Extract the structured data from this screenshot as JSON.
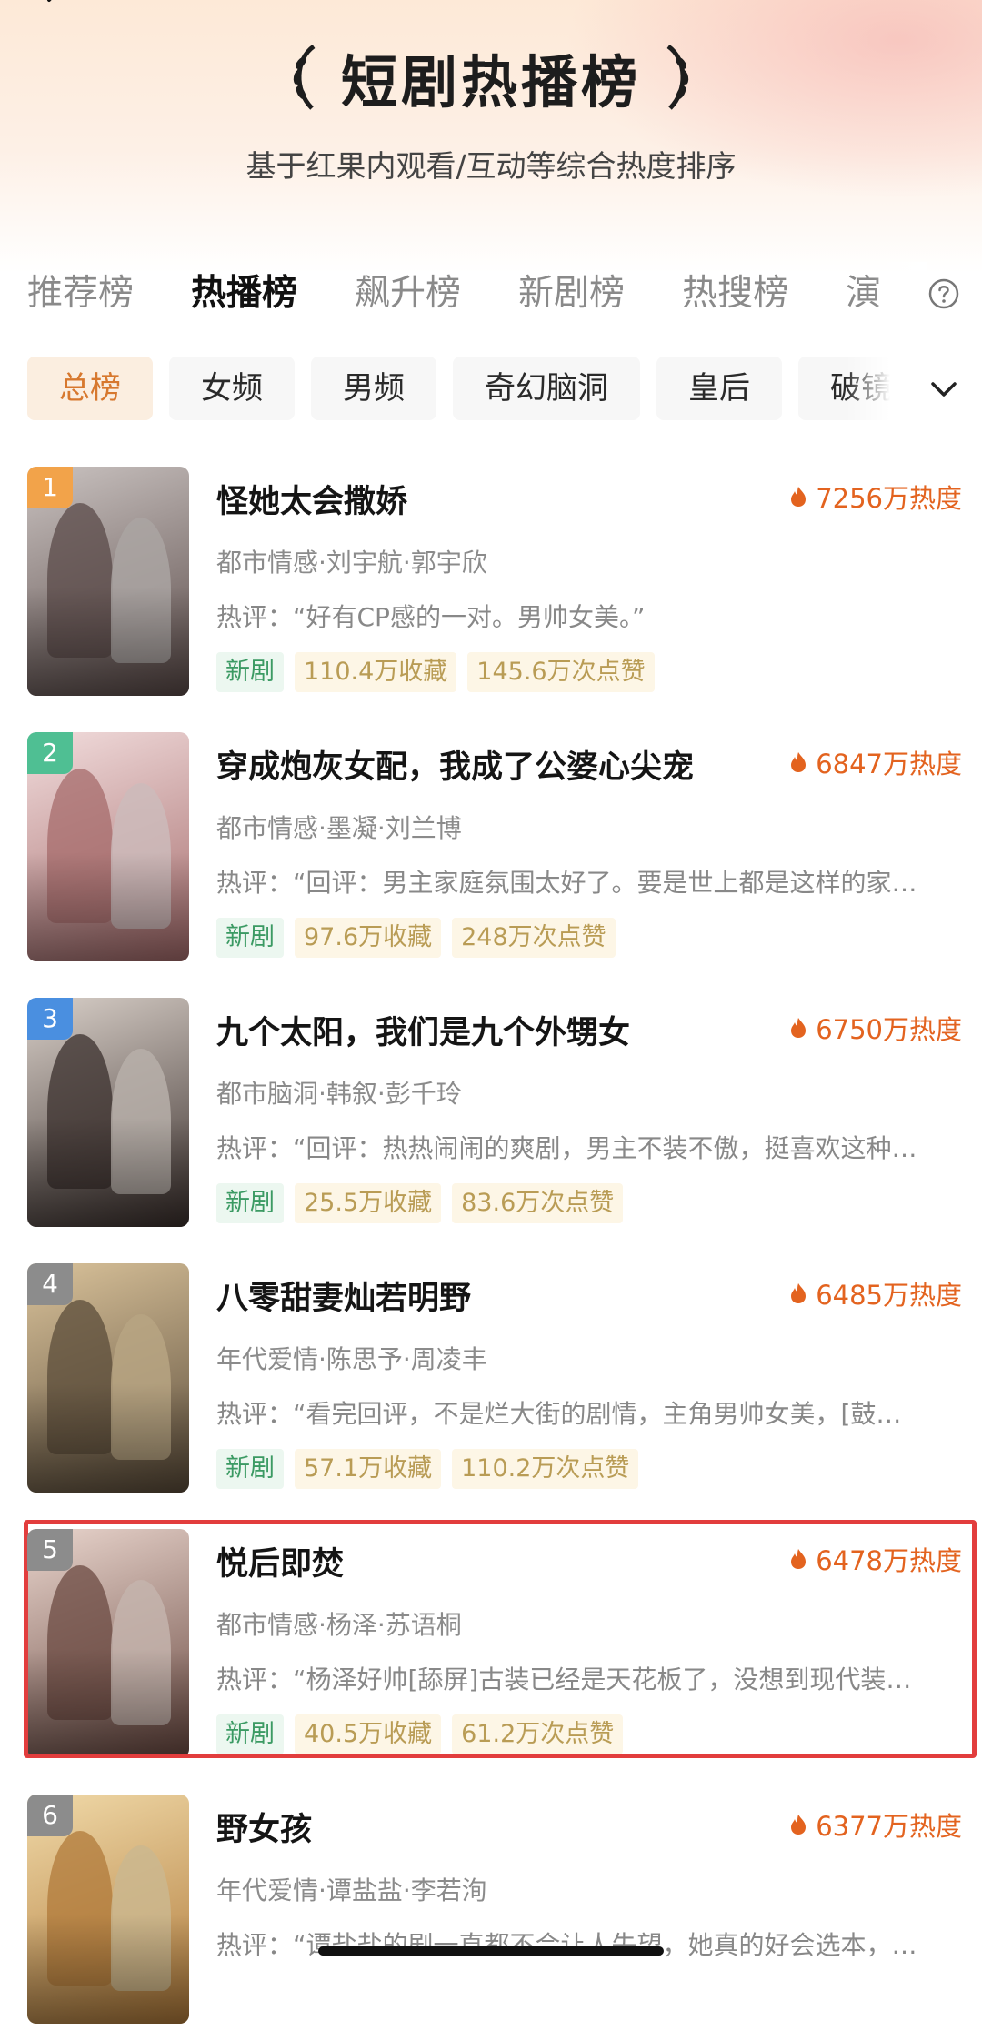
{
  "header": {
    "title": "短剧热播榜",
    "subtitle": "基于红果内观看/互动等综合热度排序"
  },
  "tabs": [
    {
      "label": "推荐榜",
      "active": false
    },
    {
      "label": "热播榜",
      "active": true
    },
    {
      "label": "飙升榜",
      "active": false
    },
    {
      "label": "新剧榜",
      "active": false
    },
    {
      "label": "热搜榜",
      "active": false
    },
    {
      "label": "演",
      "active": false
    }
  ],
  "chips": [
    {
      "label": "总榜",
      "active": true
    },
    {
      "label": "女频",
      "active": false
    },
    {
      "label": "男频",
      "active": false
    },
    {
      "label": "奇幻脑洞",
      "active": false
    },
    {
      "label": "皇后",
      "active": false
    },
    {
      "label": "破镜",
      "active": false
    }
  ],
  "colors": {
    "accent": "#e3631f",
    "chip_active_bg": "#fbeee0",
    "tag_new": "#3b9a63",
    "highlight_border": "#e23d3d"
  },
  "items": [
    {
      "rank": "1",
      "title": "怪她太会撒娇",
      "heat": "7256万热度",
      "meta": "都市情感·刘宇航·郭宇欣",
      "comment": "热评：“好有CP感的一对。男帅女美。”",
      "tag_new": "新剧",
      "favorites": "110.4万收藏",
      "likes": "145.6万次点赞",
      "badge_color": "#f2a34a",
      "poster_colors": [
        "#c9c2c0",
        "#5a4a48"
      ]
    },
    {
      "rank": "2",
      "title": "穿成炮灰女配，我成了公婆心尖宠",
      "heat": "6847万热度",
      "meta": "都市情感·墨凝·刘兰博",
      "comment": "热评：“回评：男主家庭氛围太好了。要是世上都是这样的家…",
      "tag_new": "新剧",
      "favorites": "97.6万收藏",
      "likes": "248万次点赞",
      "badge_color": "#4fbf93",
      "poster_colors": [
        "#f1dcdc",
        "#a56b6b"
      ]
    },
    {
      "rank": "3",
      "title": "九个太阳，我们是九个外甥女",
      "heat": "6750万热度",
      "meta": "都市脑洞·韩叙·彭千玲",
      "comment": "热评：“回评：热热闹闹的爽剧，男主不装不傲，挺喜欢这种…",
      "tag_new": "新剧",
      "favorites": "25.5万收藏",
      "likes": "83.6万次点赞",
      "badge_color": "#4a8fe0",
      "poster_colors": [
        "#d8cfc8",
        "#3a2f2c"
      ]
    },
    {
      "rank": "4",
      "title": "八零甜妻灿若明野",
      "heat": "6485万热度",
      "meta": "年代爱情·陈思予·周凌丰",
      "comment": "热评：“看完回评，不是烂大街的剧情，主角男帅女美，[鼓…",
      "tag_new": "新剧",
      "favorites": "57.1万收藏",
      "likes": "110.2万次点赞",
      "badge_color": "#8c8c8c",
      "poster_colors": [
        "#d9c29a",
        "#5b4c3a"
      ]
    },
    {
      "rank": "5",
      "title": "悦后即焚",
      "heat": "6478万热度",
      "meta": "都市情感·杨泽·苏语桐",
      "comment": "热评：“杨泽好帅[舔屏]古装已经是天花板了，没想到现代装…",
      "tag_new": "新剧",
      "favorites": "40.5万收藏",
      "likes": "61.2万次点赞",
      "badge_color": "#8c8c8c",
      "poster_colors": [
        "#e8d4cc",
        "#6b4a42"
      ]
    },
    {
      "rank": "6",
      "title": "野女孩",
      "heat": "6377万热度",
      "meta": "年代爱情·谭盐盐·李若洵",
      "comment": "热评：“谭盐盐的剧一直都不会让人失望，她真的好会选本，…",
      "tag_new": "",
      "favorites": "",
      "likes": "",
      "badge_color": "#8c8c8c",
      "poster_colors": [
        "#f0d9a8",
        "#b07a3a"
      ]
    }
  ]
}
